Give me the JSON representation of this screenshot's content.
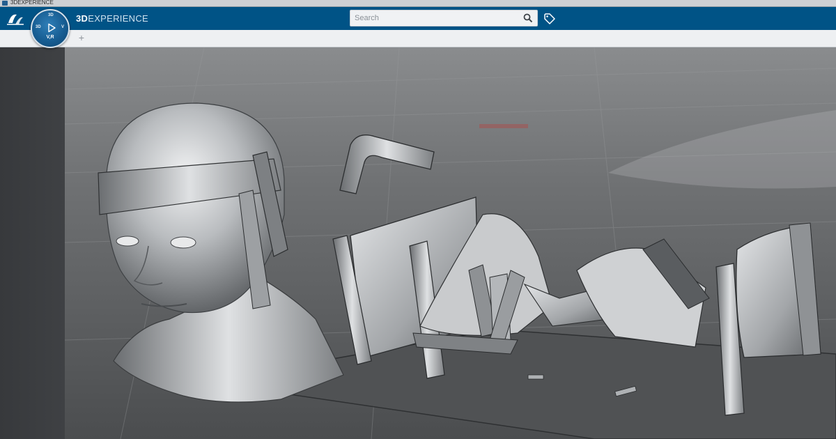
{
  "window": {
    "title": "3DEXPERIENCE"
  },
  "brand": {
    "part1": "3D",
    "part2": "EXPERIENCE"
  },
  "compass": {
    "version": "V,R",
    "segment_top": "3D",
    "segment_left": "3D",
    "segment_right": "V"
  },
  "search": {
    "placeholder": "Search"
  },
  "tabs": {
    "add_label": "+"
  },
  "icons": {
    "logo": "ds-logo-icon",
    "search": "search-icon",
    "tag": "tag-icon",
    "compass_play": "play-icon"
  },
  "colors": {
    "topbar": "#005386",
    "tabstrip": "#eef0f2",
    "left_panel": "#3a3c3f",
    "floor": "#5e6062",
    "model": "#bfc2c5"
  }
}
